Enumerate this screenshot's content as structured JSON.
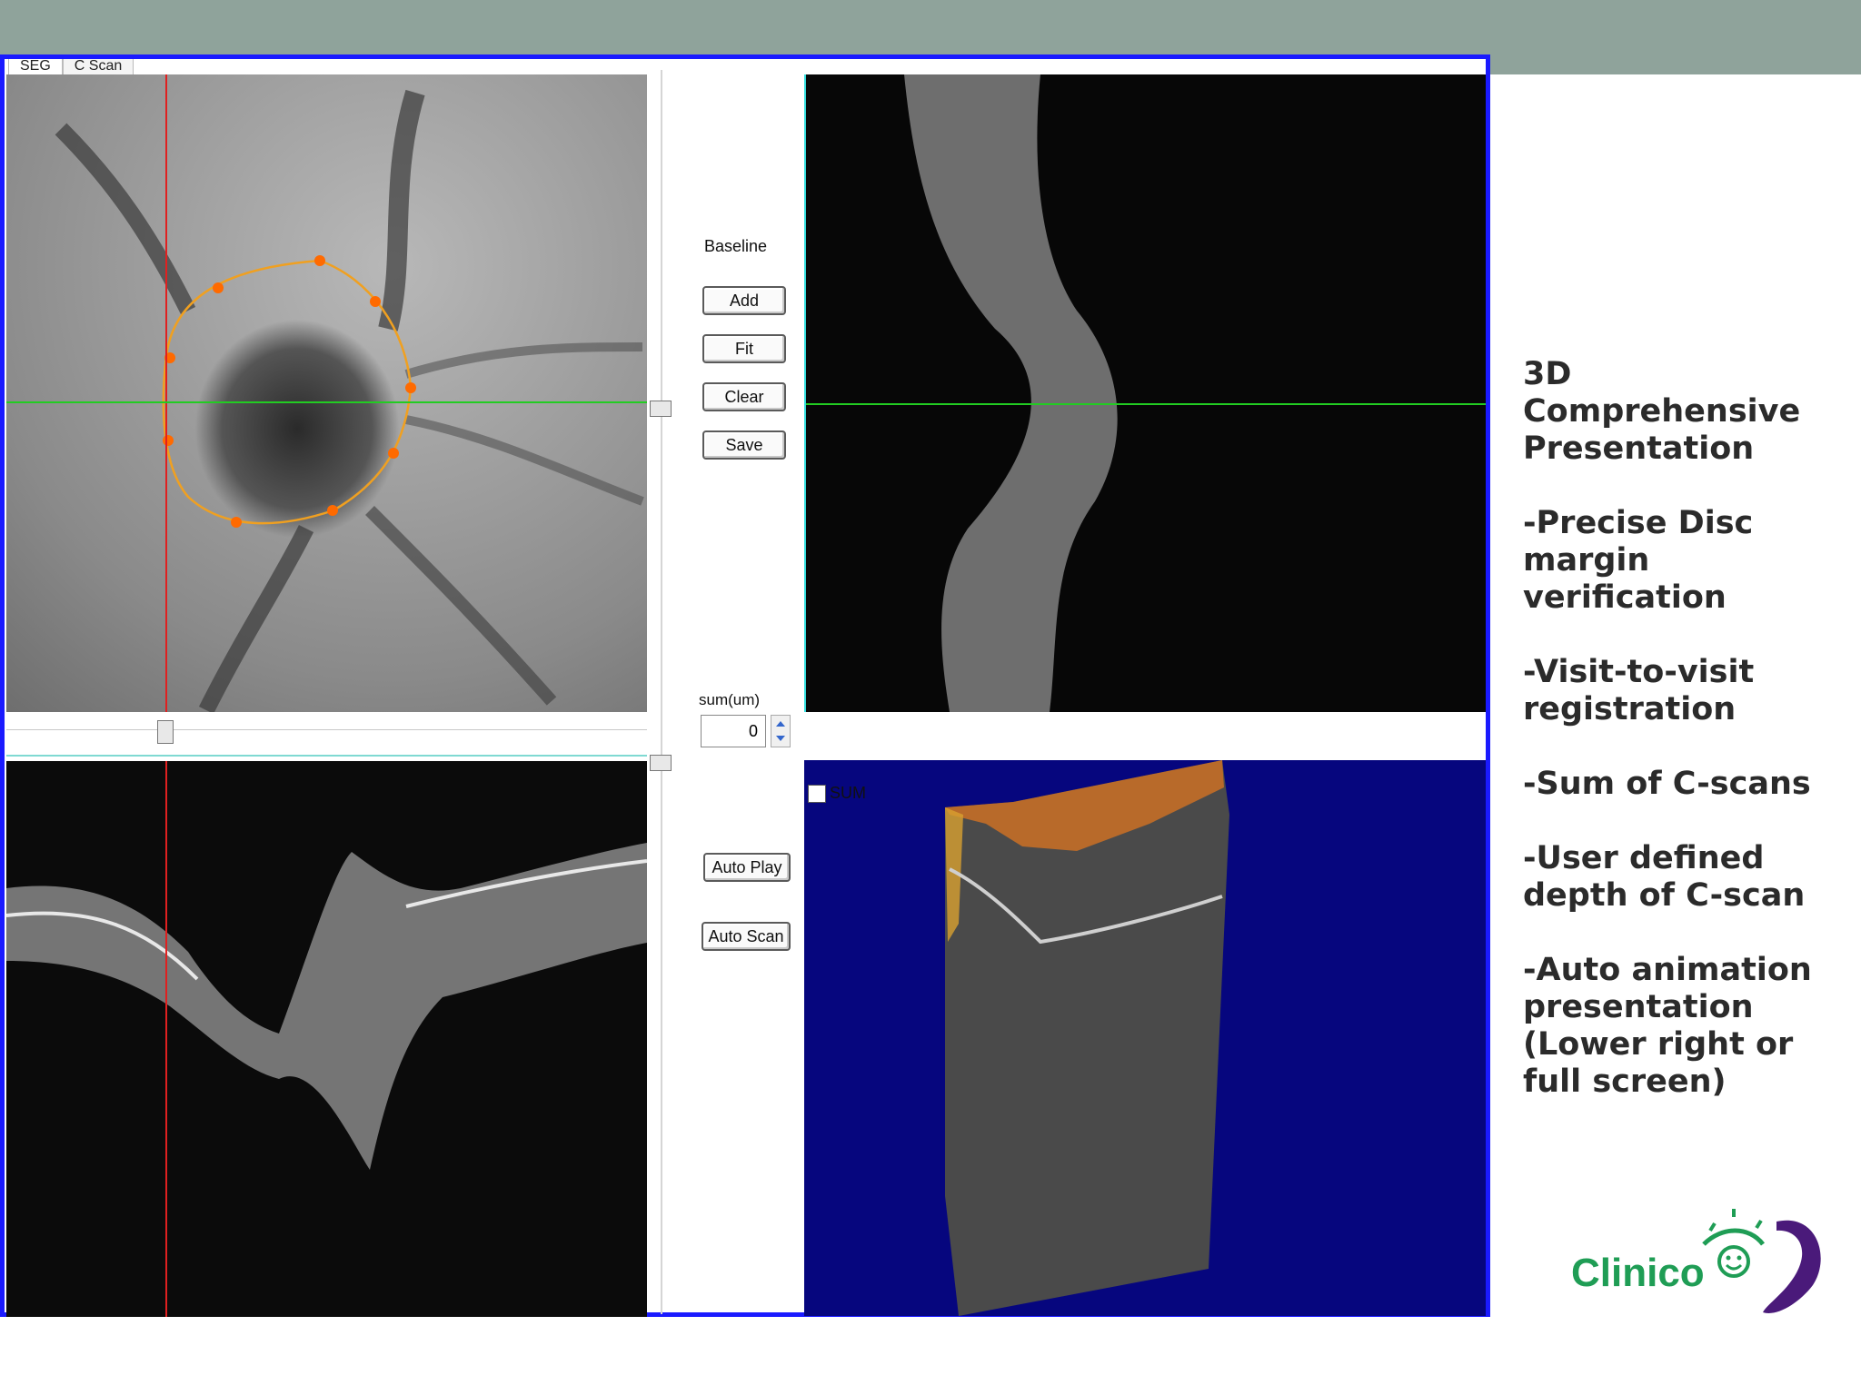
{
  "tabs": [
    "SEG",
    "C Scan"
  ],
  "controls": {
    "baseline_label": "Baseline",
    "add_label": "Add",
    "fit_label": "Fit",
    "clear_label": "Clear",
    "save_label": "Save",
    "sum_label": "sum(um)",
    "sum_value": "0",
    "sum_checkbox_label": "SUM",
    "auto_play_label": "Auto Play",
    "auto_scan_label": "Auto Scan"
  },
  "sidebar": {
    "lines": [
      "3D\nComprehensive\nPresentation",
      "-Precise Disc\nmargin\nverification",
      "-Visit-to-visit\nregistration",
      "-Sum of C-scans",
      "-User defined\ndepth of C-scan",
      "-Auto animation\npresentation\n(Lower right or\nfull screen)"
    ]
  },
  "logo": {
    "text": "Clinico"
  },
  "colors": {
    "frame": "#1a1aff",
    "topbar": "#8fa39b",
    "crosshair_vertical": "#e02020",
    "crosshair_horizontal": "#22cc22",
    "disc_margin": "#f0a020",
    "volume_bg": "#06067e",
    "logo_green": "#1f9d55",
    "logo_purple": "#4a1a7a"
  },
  "icons": [
    "spin-up-icon",
    "spin-down-icon",
    "slider-handle-icon",
    "logo-eye-icon"
  ]
}
